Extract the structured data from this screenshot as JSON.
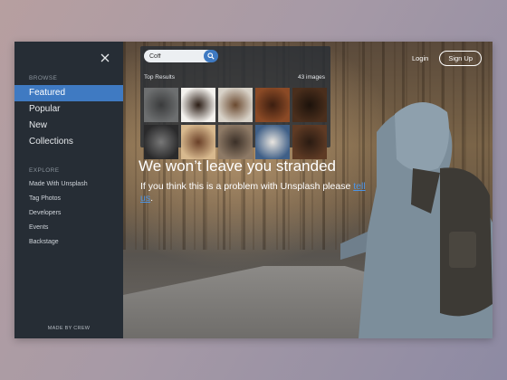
{
  "sidebar": {
    "browse_label": "BROWSE",
    "browse_items": [
      {
        "label": "Featured",
        "active": true
      },
      {
        "label": "Popular",
        "active": false
      },
      {
        "label": "New",
        "active": false
      },
      {
        "label": "Collections",
        "active": false
      }
    ],
    "explore_label": "EXPLORE",
    "explore_items": [
      {
        "label": "Made With Unsplash"
      },
      {
        "label": "Tag Photos"
      },
      {
        "label": "Developers"
      },
      {
        "label": "Events"
      },
      {
        "label": "Backstage"
      }
    ],
    "footer": "MADE BY CREW",
    "close_icon": "close-icon"
  },
  "header": {
    "login": "Login",
    "signup": "Sign Up"
  },
  "search": {
    "value": "Coff",
    "search_icon": "search-icon",
    "results_label": "Top Results",
    "results_count": "43 images"
  },
  "thumbnails": [
    {
      "subject": "coffee grinder",
      "c1": "#6d6f70",
      "c2": "#3a3b3c"
    },
    {
      "subject": "coffee cup top view",
      "c1": "#f4f2ee",
      "c2": "#2b1d15"
    },
    {
      "subject": "coffee beans",
      "c1": "#d8d2c8",
      "c2": "#6b4a30"
    },
    {
      "subject": "coffee beans close",
      "c1": "#8b4a26",
      "c2": "#3c1e10"
    },
    {
      "subject": "coffee beans dark",
      "c1": "#4a2e1c",
      "c2": "#1c120b"
    },
    {
      "subject": "espresso machine",
      "c1": "#2a2a2b",
      "c2": "#777"
    },
    {
      "subject": "latte art",
      "c1": "#d8b98e",
      "c2": "#6a4028"
    },
    {
      "subject": "coffee cup table",
      "c1": "#8e7a66",
      "c2": "#3b3028"
    },
    {
      "subject": "blue coffee cup",
      "c1": "#3f5f87",
      "c2": "#e9e5df"
    },
    {
      "subject": "coffee beans mix",
      "c1": "#5e3a24",
      "c2": "#2a1b12"
    }
  ],
  "hero": {
    "title": "We won’t leave you stranded",
    "subtitle_prefix": "If you think this is a problem with Unsplash please ",
    "subtitle_link": "tell us",
    "subtitle_suffix": "."
  },
  "colors": {
    "accent": "#3f7ac2",
    "sidebar_bg": "#262d35",
    "link": "#4d95e6"
  }
}
